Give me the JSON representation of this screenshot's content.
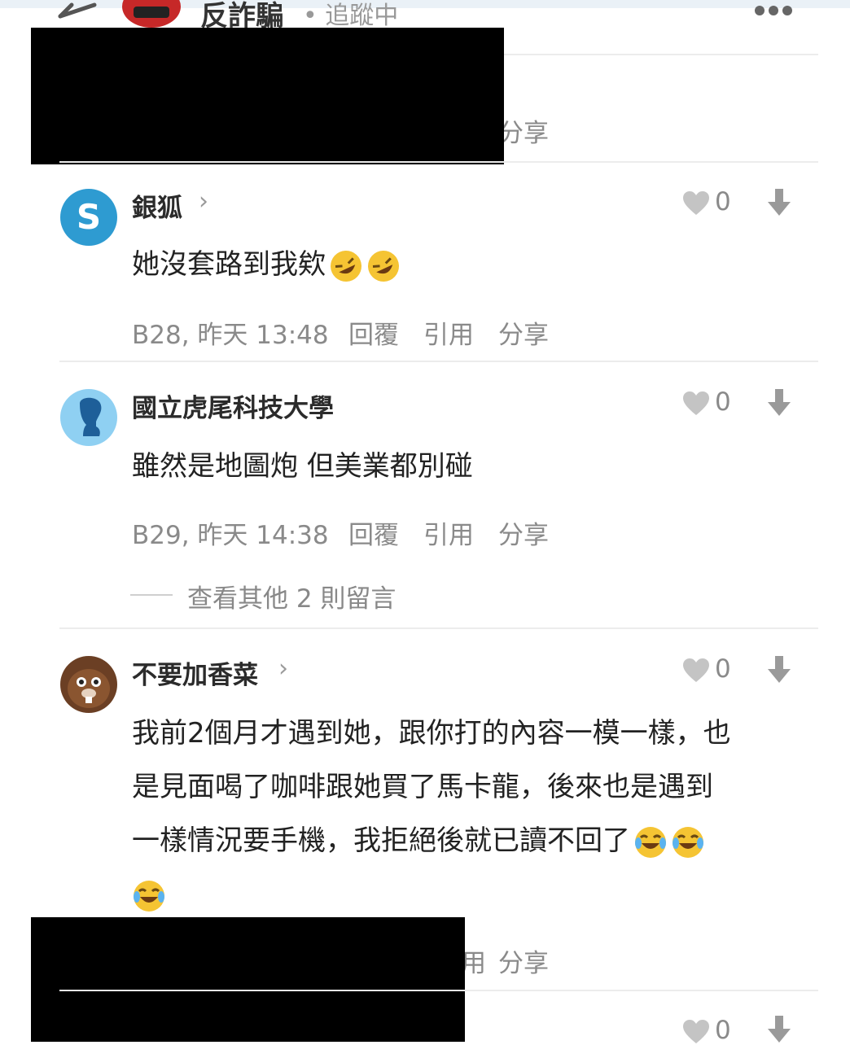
{
  "header": {
    "title": "反詐騙",
    "status": "• 追蹤中",
    "back_icon": "back-arrow-icon",
    "more_icon": "more-dots-icon"
  },
  "partial_meta_top": {
    "share": "分享"
  },
  "comments": [
    {
      "username": "銀狐",
      "avatar_letter": "S",
      "content": "她沒套路到我欸",
      "emojis": [
        "rolling-on-floor-laughing",
        "rolling-on-floor-laughing"
      ],
      "floor_time": "B28, 昨天 13:48",
      "reply": "回覆",
      "quote": "引用",
      "share": "分享",
      "likes": "0"
    },
    {
      "username": "國立虎尾科技大學",
      "content": "雖然是地圖炮 但美業都別碰",
      "floor_time": "B29, 昨天 14:38",
      "reply": "回覆",
      "quote": "引用",
      "share": "分享",
      "likes": "0",
      "view_more": "查看其他 2 則留言"
    },
    {
      "username": "不要加香菜",
      "content_lines": [
        "我前2個月才遇到她，跟你打的內容一模一樣，也",
        "是見面喝了咖啡跟她買了馬卡龍，後來也是遇到",
        "一樣情況要手機，我拒絕後就已讀不回了"
      ],
      "emojis": [
        "tears-of-joy",
        "tears-of-joy",
        "tears-of-joy"
      ],
      "likes": "0"
    }
  ],
  "partial_meta_bottom": {
    "quote_fragment": "用",
    "share": "分享"
  },
  "bottom_comment": {
    "likes": "0"
  }
}
